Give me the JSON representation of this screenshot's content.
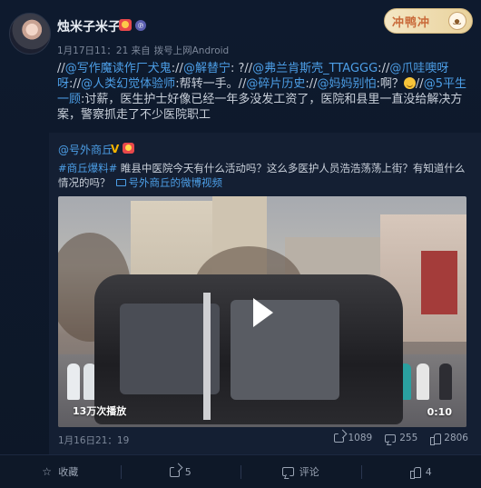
{
  "post": {
    "username": "烛米子米子",
    "meta": "1月17日11：21 来自",
    "source": "拨号上网Android",
    "text_parts": [
      {
        "type": "sep",
        "text": "//"
      },
      {
        "type": "mention",
        "text": "@写作魔读作厂犬鬼"
      },
      {
        "type": "sep",
        "text": ":"
      },
      {
        "type": "sep",
        "text": "//"
      },
      {
        "type": "mention",
        "text": "@解替宁"
      },
      {
        "type": "sep",
        "text": ": ?"
      },
      {
        "type": "sep",
        "text": "//"
      },
      {
        "type": "mention",
        "text": "@弗兰肯斯壳_TTAGGG"
      },
      {
        "type": "sep",
        "text": ":"
      },
      {
        "type": "sep",
        "text": "//"
      },
      {
        "type": "mention",
        "text": "@爪哇噢呀呀"
      },
      {
        "type": "sep",
        "text": ":"
      },
      {
        "type": "sep",
        "text": "//"
      },
      {
        "type": "mention",
        "text": "@人类幻觉体验师"
      },
      {
        "type": "sep",
        "text": ":帮转一手。"
      },
      {
        "type": "sep",
        "text": "//"
      },
      {
        "type": "mention",
        "text": "@碎片历史"
      },
      {
        "type": "sep",
        "text": ":"
      },
      {
        "type": "sep",
        "text": "//"
      },
      {
        "type": "mention",
        "text": "@妈妈别怕"
      },
      {
        "type": "sep",
        "text": ":啊？"
      },
      {
        "type": "emoji",
        "text": ""
      },
      {
        "type": "sep",
        "text": "//"
      },
      {
        "type": "mention",
        "text": "@5平生一顾"
      },
      {
        "type": "sep",
        "text": ":讨薪，医生护士好像已经一年多没发工资了，医院和县里一直没给解决方案，警察抓走了不少医院职工"
      }
    ],
    "decor_badge": "冲鸭冲"
  },
  "repost": {
    "author": "@号外商丘",
    "v_badge": "V",
    "tag": "#商丘爆料#",
    "text": " 睢县中医院今天有什么活动吗？这么多医护人员浩浩荡荡上街？有知道什么情况的吗？",
    "video_link": "号外商丘的微博视频",
    "video": {
      "views": "13万次播放",
      "duration": "0:10"
    },
    "date": "1月16日21：19",
    "stats": {
      "shares": "1089",
      "comments": "255",
      "likes": "2806"
    }
  },
  "footer": {
    "favorite": "收藏",
    "forward_count": "5",
    "comment": "评论",
    "like_count": "4"
  }
}
